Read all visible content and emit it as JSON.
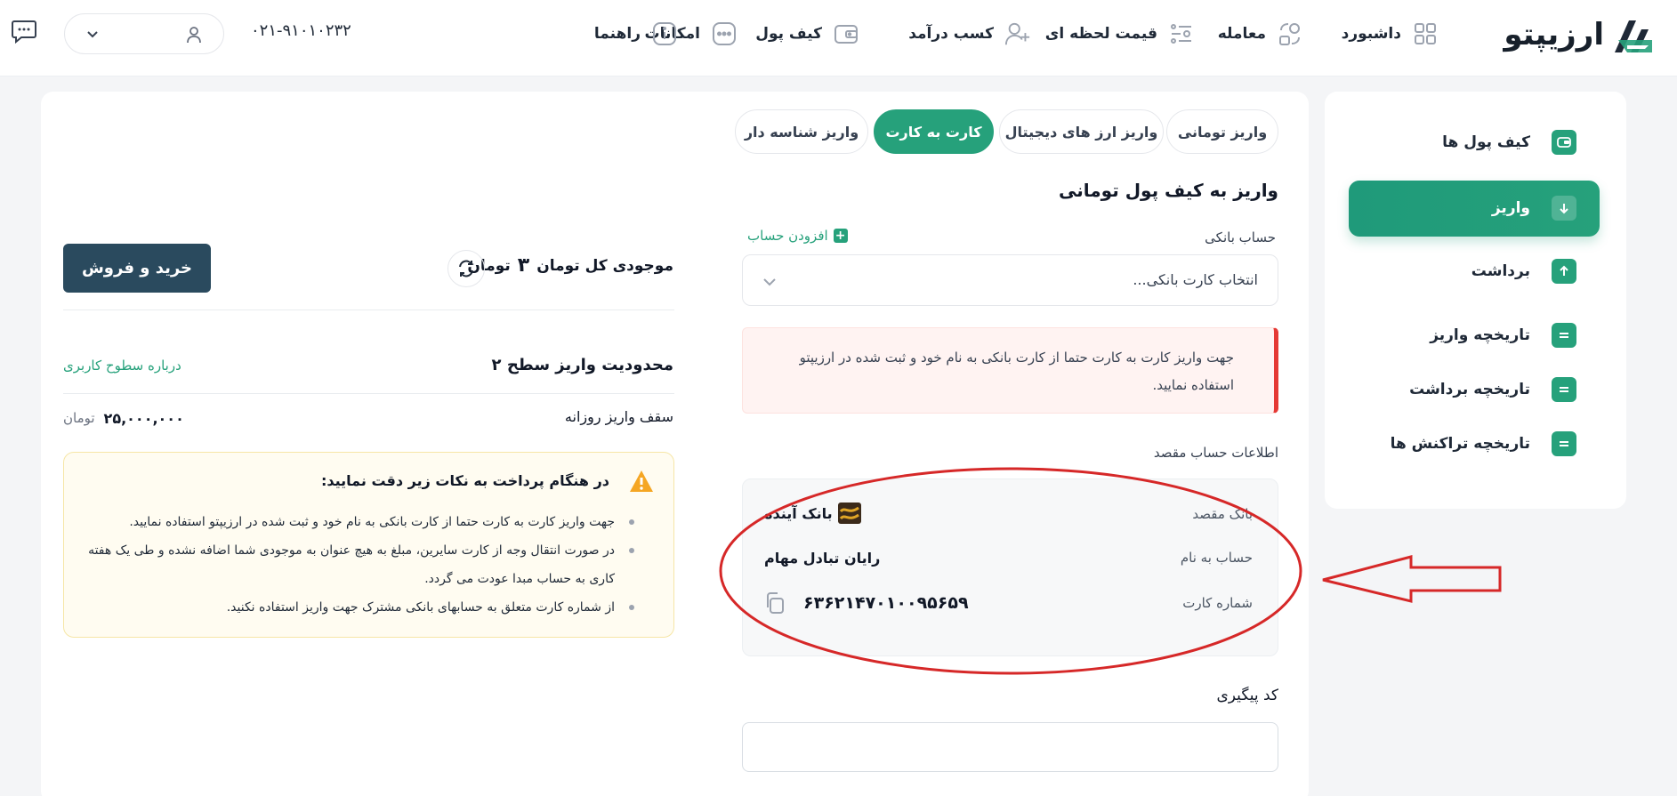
{
  "header": {
    "logo_text": "ارزیپتو",
    "nav": [
      {
        "label": "داشبورد",
        "icon": "grid-icon"
      },
      {
        "label": "معامله",
        "icon": "trade-icon"
      },
      {
        "label": "قیمت لحظه ای",
        "icon": "price-list-icon"
      },
      {
        "label": "کسب درآمد",
        "icon": "add-user-icon"
      },
      {
        "label": "کیف پول",
        "icon": "wallet-icon"
      },
      {
        "label": "امکانات",
        "icon": "more-icon"
      },
      {
        "label": "راهنما",
        "icon": "info-icon"
      }
    ],
    "phone": "۰۲۱-۹۱۰۱۰۲۳۲"
  },
  "sidebar": {
    "items": [
      {
        "label": "کیف پول ها",
        "icon": "wallet-icon"
      },
      {
        "label": "واریز",
        "icon": "arrow-down-icon"
      },
      {
        "label": "برداشت",
        "icon": "arrow-up-icon"
      },
      {
        "label": "تاریخچه واریز",
        "icon": "history-icon"
      },
      {
        "label": "تاریخچه برداشت",
        "icon": "history-icon"
      },
      {
        "label": "تاریخچه تراکنش ها",
        "icon": "history-icon"
      }
    ]
  },
  "tabs": [
    "واریز تومانی",
    "واریز ارز های دیجیتال",
    "کارت به کارت",
    "واریز شناسه دار"
  ],
  "deposit": {
    "title": "واریز به کیف پول تومانی",
    "bank_account_label": "حساب بانکی",
    "add_account": "افزودن حساب",
    "select_placeholder": "انتخاب کارت بانکی...",
    "alert": "جهت واریز کارت به کارت حتما از کارت بانکی به نام خود و ثبت شده در ارزیپتو استفاده نمایید.",
    "dest_section": "اطلاعات حساب مقصد",
    "dest_bank_label": "بانک مقصد",
    "dest_bank_value": "بانک آینده",
    "dest_name_label": "حساب به نام",
    "dest_name_value": "رایان تبادل مهام",
    "dest_card_label": "شماره کارت",
    "dest_card_value": "۶۳۶۲۱۴۷۰۱۰۰۹۵۶۵۹",
    "tracking_label": "کد پیگیری"
  },
  "summary": {
    "balance_label": "موجودی کل تومان",
    "balance_value": "۳",
    "balance_unit": "تومان",
    "trade_button": "خرید و فروش",
    "limit_title": "محدودیت واریز سطح ۲",
    "levels_link": "درباره سطوح کاربری",
    "daily_label": "سقف واریز روزانه",
    "daily_value": "۲۵,۰۰۰,۰۰۰",
    "daily_unit": "تومان"
  },
  "note": {
    "title": "در هنگام پرداخت به نکات زیر دقت نمایید:",
    "items": [
      "جهت واریز کارت به کارت حتما از کارت بانکی به نام خود و ثبت شده در ارزیپتو استفاده نمایید.",
      "در صورت انتقال وجه از کارت سایرین، مبلغ به هیچ عنوان به موجودی شما اضافه نشده و طی یک هفته کاری به حساب مبدا عودت می گردد.",
      "از شماره کارت متعلق به حسابهای بانکی مشترک جهت واریز استفاده نکنید."
    ]
  },
  "colors": {
    "accent": "#26a17b",
    "dark": "#2a4a5e",
    "alert": "#e53935",
    "annotation": "#d62828"
  }
}
